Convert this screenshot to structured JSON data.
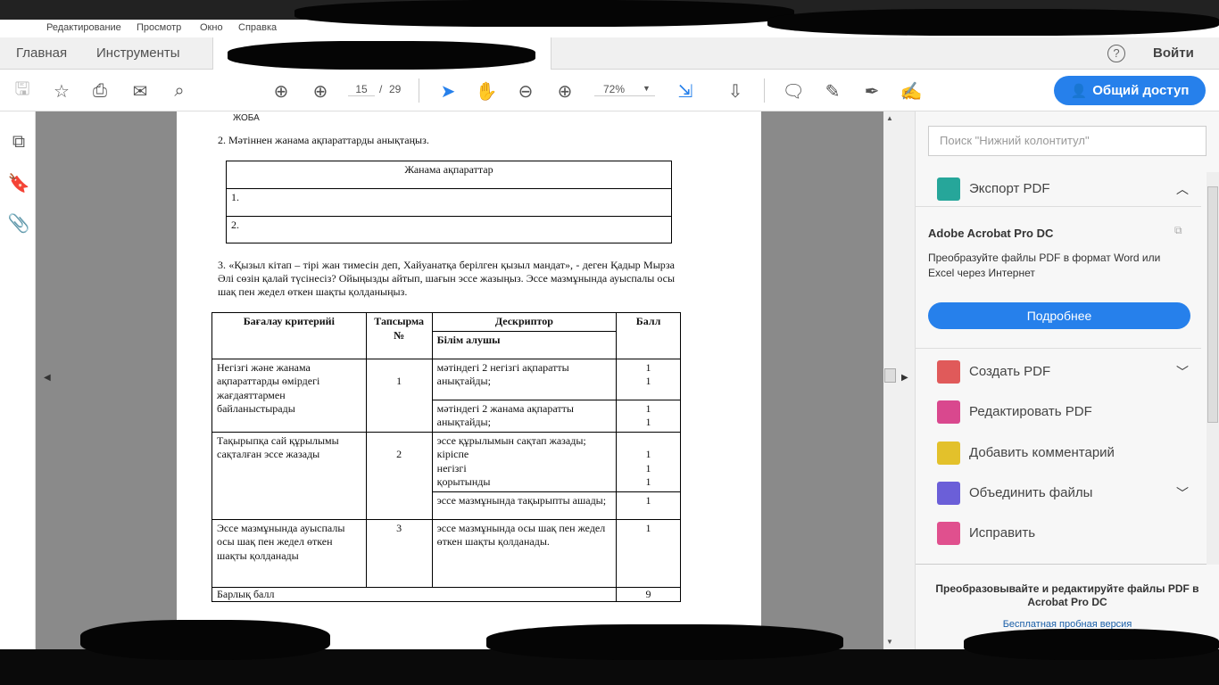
{
  "menu": [
    "Редактирование",
    "Просмотр",
    "Окно",
    "Справка"
  ],
  "tabs": {
    "home": "Главная",
    "tools": "Инструменты"
  },
  "header": {
    "help": "?",
    "signin": "Войти"
  },
  "toolbar": {
    "page_current": "15",
    "page_sep": "/",
    "page_total": "29",
    "zoom": "72%",
    "share": "Общий доступ"
  },
  "document": {
    "header_label": "ЖОБА",
    "q2": "2. Мәтіннен жанама ақпараттарды анықтаңыз.",
    "info_table": {
      "header": "Жанама ақпараттар",
      "rows": [
        "1.",
        "2."
      ]
    },
    "q3": "3. «Қызыл кітап – тірі жан тимесін деп, Хайуанатқа берілген қызыл мандат», - деген Қадыр Мырза Әлі сөзін қалай түсінесіз? Ойыңызды айтып, шағын эссе жазыңыз. Эссе мазмұнында  ауыспалы осы шақ пен  жедел өткен шақты  қолданыңыз.",
    "rubric": {
      "headers": {
        "criteria": "Бағалау критерийі",
        "task": "Тапсырма №",
        "descriptor": "Дескриптор",
        "descriptor_sub": "Білім алушы",
        "score": "Балл"
      },
      "rows": [
        {
          "criteria": "Негізгі және жанама ақпараттарды өмірдегі жағдаяттармен байланыстырады",
          "task": "1",
          "descriptors": [
            {
              "text": "мәтіндегі 2  негізгі ақпаратты анықтайды;",
              "score": "1\n1"
            },
            {
              "text": "мәтіндегі 2 жанама ақпаратты анықтайды;",
              "score": "1\n1"
            }
          ]
        },
        {
          "criteria": "Тақырыпқа сай құрылымы сақталған эссе жазады",
          "task": "2",
          "descriptors": [
            {
              "text": "эссе құрылымын сақтап жазады;\nкіріспе\nнегізгі\nқорытынды",
              "score": "\n1\n1\n1"
            },
            {
              "text": "эссе мазмұнында тақырыпты ашады;",
              "score": "1"
            }
          ]
        },
        {
          "criteria": "Эссе мазмұнында ауыспалы осы шақ пен жедел өткен шақты қолданады",
          "task": "3",
          "descriptors": [
            {
              "text": "эссе мазмұнында осы шақ пен жедел өткен шақты қолданады.",
              "score": "1"
            }
          ]
        }
      ],
      "total_label": "Барлық балл",
      "total": "9"
    }
  },
  "panel": {
    "search_placeholder": "Поиск \"Нижний колонтитул\"",
    "export": "Экспорт PDF",
    "promo_title": "Adobe Acrobat Pro DC",
    "promo_text": "Преобразуйте файлы PDF в формат Word или Excel через Интернет",
    "promo_button": "Подробнее",
    "tools": [
      "Создать PDF",
      "Редактировать PDF",
      "Добавить комментарий",
      "Объединить файлы",
      "Исправить"
    ],
    "footer_text": "Преобразовывайте и редактируйте файлы PDF в Acrobat Pro DC",
    "footer_link": "Бесплатная пробная версия"
  },
  "colors": {
    "accent": "#2680eb",
    "viewer_bg": "#8a8a8a"
  }
}
